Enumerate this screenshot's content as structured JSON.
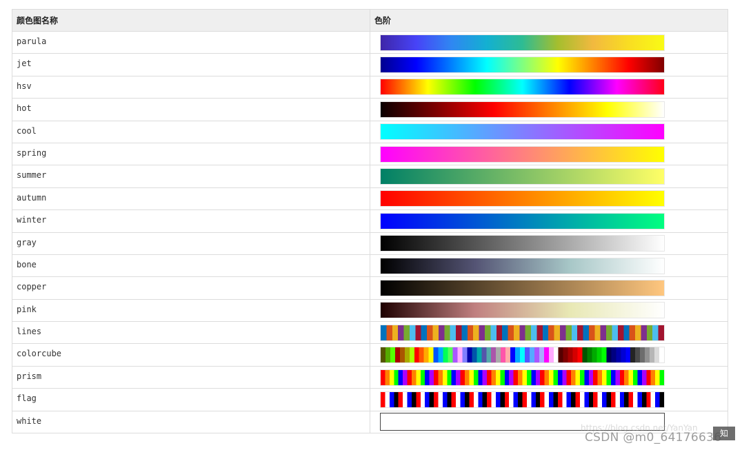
{
  "table": {
    "headers": {
      "name": "颜色图名称",
      "scale": "色阶"
    },
    "rows": [
      {
        "name": "parula",
        "kind": "gradient",
        "colors": [
          "#3e26a8",
          "#4743f7",
          "#2f87f2",
          "#13b0d1",
          "#2ebc93",
          "#a5be2e",
          "#f2b93f",
          "#f9dd22",
          "#f9fb15"
        ]
      },
      {
        "name": "jet",
        "kind": "gradient",
        "colors": [
          "#00008f",
          "#0000ff",
          "#0080ff",
          "#00ffff",
          "#80ff80",
          "#ffff00",
          "#ff8000",
          "#ff0000",
          "#800000"
        ]
      },
      {
        "name": "hsv",
        "kind": "gradient",
        "colors": [
          "#ff0000",
          "#ffff00",
          "#00ff00",
          "#00ffff",
          "#0000ff",
          "#ff00ff",
          "#ff0018"
        ]
      },
      {
        "name": "hot",
        "kind": "gradient",
        "colors": [
          "#0b0000",
          "#800000",
          "#ff0000",
          "#ff8000",
          "#ffff00",
          "#ffffff"
        ]
      },
      {
        "name": "cool",
        "kind": "gradient",
        "colors": [
          "#00ffff",
          "#ff00ff"
        ]
      },
      {
        "name": "spring",
        "kind": "gradient",
        "colors": [
          "#ff00ff",
          "#ffff00"
        ]
      },
      {
        "name": "summer",
        "kind": "gradient",
        "colors": [
          "#008066",
          "#ffff66"
        ]
      },
      {
        "name": "autumn",
        "kind": "gradient",
        "colors": [
          "#ff0000",
          "#ffff00"
        ]
      },
      {
        "name": "winter",
        "kind": "gradient",
        "colors": [
          "#0000ff",
          "#00ff80"
        ]
      },
      {
        "name": "gray",
        "kind": "gradient",
        "colors": [
          "#000000",
          "#ffffff"
        ]
      },
      {
        "name": "bone",
        "kind": "gradient",
        "colors": [
          "#000000",
          "#545474",
          "#a7c7c7",
          "#ffffff"
        ]
      },
      {
        "name": "copper",
        "kind": "gradient",
        "colors": [
          "#000000",
          "#ffc77f"
        ]
      },
      {
        "name": "pink",
        "kind": "gradient",
        "colors": [
          "#1e0000",
          "#c08080",
          "#e8e8b4",
          "#ffffff"
        ]
      },
      {
        "name": "lines",
        "kind": "stripes",
        "colors": [
          "#0072bd",
          "#d95319",
          "#edb120",
          "#7e2f8e",
          "#77ac30",
          "#4dbeee",
          "#a2142f"
        ],
        "count": 49
      },
      {
        "name": "colorcube",
        "kind": "segments",
        "colors": [
          "#555500",
          "#55aa00",
          "#55ff00",
          "#aa0000",
          "#aa5500",
          "#aaaa00",
          "#aaff00",
          "#ff0000",
          "#ff5500",
          "#ffaa00",
          "#ffff00",
          "#0055ff",
          "#00aaff",
          "#00ff55",
          "#55ff55",
          "#aa55ff",
          "#ffaaff",
          "#8080ff",
          "#0000aa",
          "#0055aa",
          "#00aaaa",
          "#5555aa",
          "#55aaaa",
          "#aa55aa",
          "#aaaaaa",
          "#ff55aa",
          "#ffaaaa",
          "#0000ff",
          "#00aaff",
          "#00ffff",
          "#5555ff",
          "#55aaff",
          "#aa55ff",
          "#aaaaff",
          "#ff00ff",
          "#ffaaff",
          "#ffffff",
          "#550000",
          "#800000",
          "#aa0000",
          "#d40000",
          "#ff0000",
          "#005500",
          "#008000",
          "#00aa00",
          "#00d400",
          "#00ff00",
          "#000055",
          "#000080",
          "#0000aa",
          "#0000d4",
          "#0000ff",
          "#242424",
          "#494949",
          "#6d6d6d",
          "#929292",
          "#b6b6b6",
          "#dbdbdb",
          "#ffffff"
        ]
      },
      {
        "name": "prism",
        "kind": "stripes",
        "colors": [
          "#ff0000",
          "#ff8000",
          "#ffff00",
          "#00ff00",
          "#0000ff",
          "#aa00ff"
        ],
        "count": 64
      },
      {
        "name": "flag",
        "kind": "stripes",
        "colors": [
          "#ff0000",
          "#ffffff",
          "#0000ff",
          "#000000"
        ],
        "count": 64
      },
      {
        "name": "white",
        "kind": "solid",
        "colors": [
          "#ffffff"
        ]
      }
    ]
  },
  "watermark": {
    "faint": "https://blog.csdn.net/YanYan",
    "main": "CSDN @m0_64176636",
    "badge": "知"
  }
}
